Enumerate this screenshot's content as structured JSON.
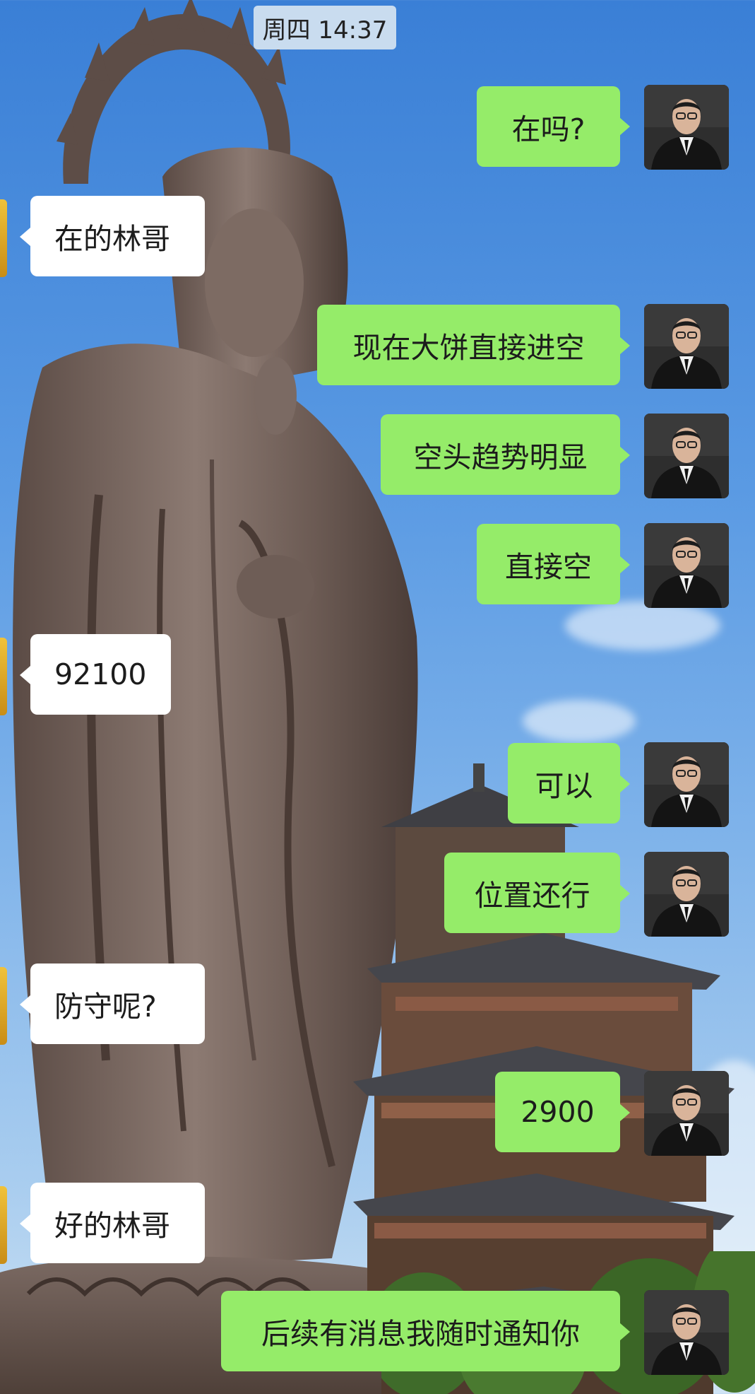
{
  "status": {
    "time": "周四 14:37"
  },
  "messages": [
    {
      "from": "me",
      "text": "在吗?"
    },
    {
      "from": "other",
      "text": "在的林哥"
    },
    {
      "from": "me",
      "text": "现在大饼直接进空"
    },
    {
      "from": "me",
      "text": "空头趋势明显"
    },
    {
      "from": "me",
      "text": "直接空"
    },
    {
      "from": "other",
      "text": "92100"
    },
    {
      "from": "me",
      "text": "可以"
    },
    {
      "from": "me",
      "text": "位置还行"
    },
    {
      "from": "other",
      "text": "防守呢?"
    },
    {
      "from": "me",
      "text": "2900"
    },
    {
      "from": "other",
      "text": "好的林哥"
    },
    {
      "from": "me",
      "text": "后续有消息我随时通知你"
    }
  ],
  "colors": {
    "me_bubble": "#95ec69",
    "other_bubble": "#ffffff",
    "sky": "#3a7fd6"
  },
  "icons": {
    "me_avatar": "user-avatar-icon",
    "other_avatar": "contact-avatar-icon"
  }
}
